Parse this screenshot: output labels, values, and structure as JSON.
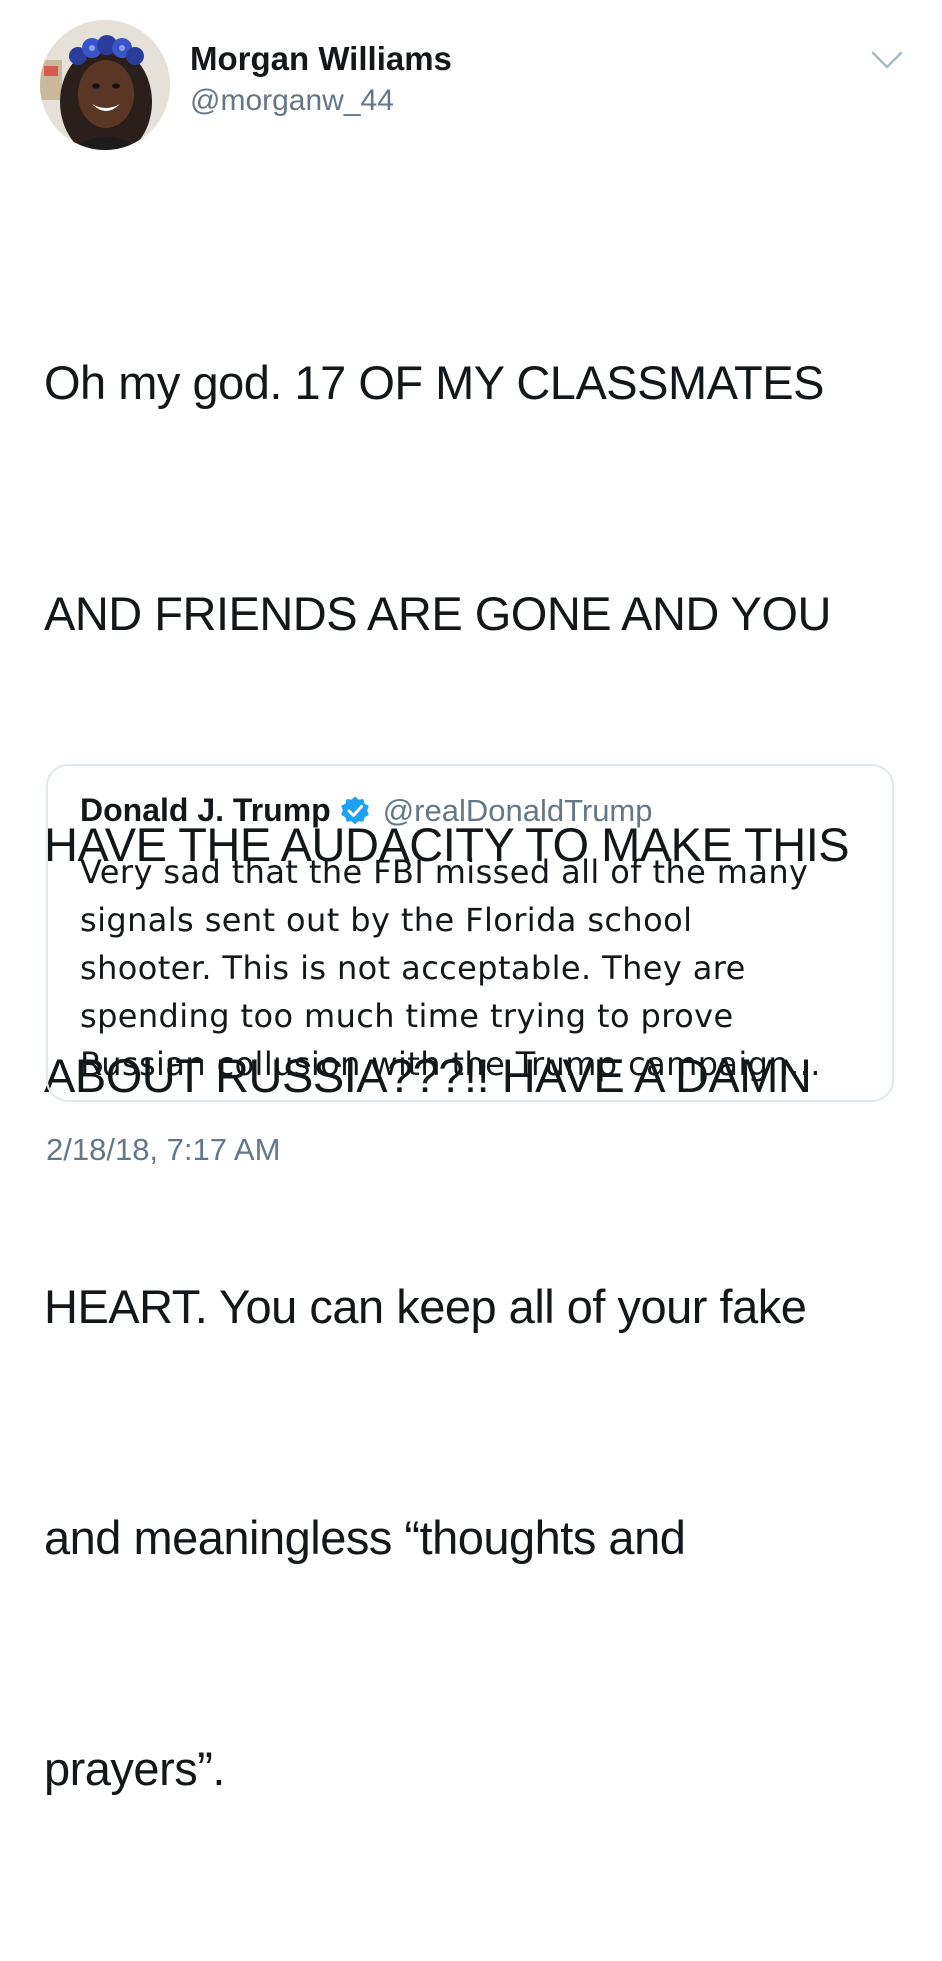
{
  "tweet": {
    "author": {
      "name": "Morgan Williams",
      "handle": "@morganw_44"
    },
    "text_lines": [
      "Oh my god. 17 OF MY CLASSMATES",
      "AND FRIENDS ARE GONE AND YOU",
      "HAVE THE AUDACITY TO MAKE THIS",
      "ABOUT RUSSIA???!! HAVE A DAMN",
      "HEART. You can keep all of your fake",
      "and meaningless “thoughts and",
      "prayers”."
    ],
    "timestamp": "2/18/18, 7:17 AM",
    "menu_icon": "chevron-down-icon"
  },
  "quoted_tweet": {
    "author": {
      "name": "Donald J. Trump",
      "handle": "@realDonaldTrump",
      "verified_icon": "verified-badge-icon"
    },
    "text_lines": [
      "Very sad that the FBI missed all of the many",
      "signals sent out by the Florida school",
      "shooter. This is not acceptable. They are",
      "spending too much time trying to prove",
      "Russian collusion with the Trump campaign..."
    ]
  },
  "colors": {
    "text_primary": "#14171a",
    "text_secondary": "#657786",
    "border": "#e1e8ed",
    "verified_blue": "#1da1f2"
  }
}
